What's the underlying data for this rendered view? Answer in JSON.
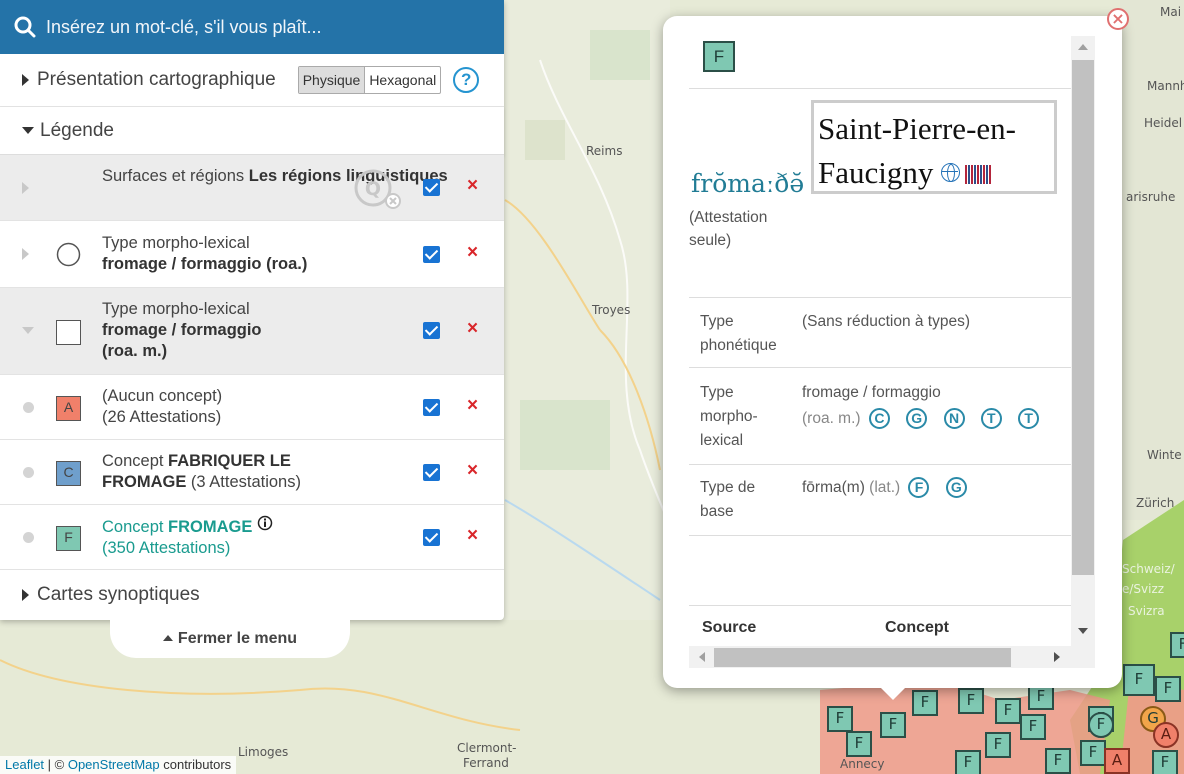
{
  "search": {
    "placeholder": "Insérez un mot-clé, s'il vous plaît..."
  },
  "presentation": {
    "label": "Présentation cartographique",
    "options": [
      "Physique",
      "Hexagonal"
    ],
    "selected": "Physique",
    "help": "?"
  },
  "legend": {
    "label": "Légende"
  },
  "layers": [
    {
      "prefix": "Surfaces et régions ",
      "bold": "Les régions linguistiques",
      "line2": "",
      "checked": true
    },
    {
      "prefix": "Type morpho-lexical",
      "bold": "fromage / formaggio (roa.)",
      "line2": "",
      "checked": true
    },
    {
      "prefix": "Type morpho-lexical",
      "bold": "fromage / formaggio",
      "line2": "(roa. m.)",
      "checked": true
    }
  ],
  "concepts": [
    {
      "symbol": "A",
      "color": "#f0806a",
      "line1": "(Aucun concept)",
      "line2": "(26 Attestations)",
      "checked": true
    },
    {
      "symbol": "C",
      "color": "#6f9fcc",
      "prefix": "Concept ",
      "bold": "FABRIQUER LE",
      "bold2": "FROMAGE",
      "count": " (3 Attestations)",
      "checked": true
    },
    {
      "symbol": "F",
      "color": "#7fc8b2",
      "prefix": "Concept ",
      "bold": "FROMAGE",
      "count": "(350 Attestations)",
      "checked": true
    }
  ],
  "synoptic": {
    "label": "Cartes synoptiques"
  },
  "close_menu": {
    "label": "Fermer le menu"
  },
  "delete_glyph": "×",
  "map": {
    "cities": [
      "Reims",
      "Troyes",
      "Limoges",
      "Clermont-",
      "Ferrand",
      "Annecy",
      "Mannheim",
      "Heidel",
      "Zürich",
      "Winte",
      "arisruhe",
      "Mai",
      "Schweiz/",
      "e/Svizz",
      "Svizra"
    ],
    "attribution": {
      "leaflet": "Leaflet",
      "sep": " | © ",
      "osm": "OpenStreetMap",
      "suffix": " contributors"
    },
    "marker_letters": {
      "f": "F",
      "a": "A",
      "g": "G"
    }
  },
  "popup": {
    "badge": "F",
    "phonetic": "frŏmaːðə̆",
    "attestation": "(Attestation seule)",
    "place": "Saint-Pierre-en-Faucigny",
    "rows": [
      {
        "label": "Type phonétique",
        "value": "(Sans réduction à types)",
        "note": "",
        "links": []
      },
      {
        "label": "Type morpho-lexical",
        "value": "fromage / formaggio",
        "note": "(roa. m.)",
        "links": [
          "C",
          "G",
          "N",
          "T",
          "T"
        ]
      },
      {
        "label": "Type de base",
        "value": "fōrma(m)",
        "note": "(lat.)",
        "links": [
          "F",
          "G"
        ]
      }
    ],
    "table_headers": [
      "Source",
      "Concept"
    ],
    "close": "×"
  }
}
